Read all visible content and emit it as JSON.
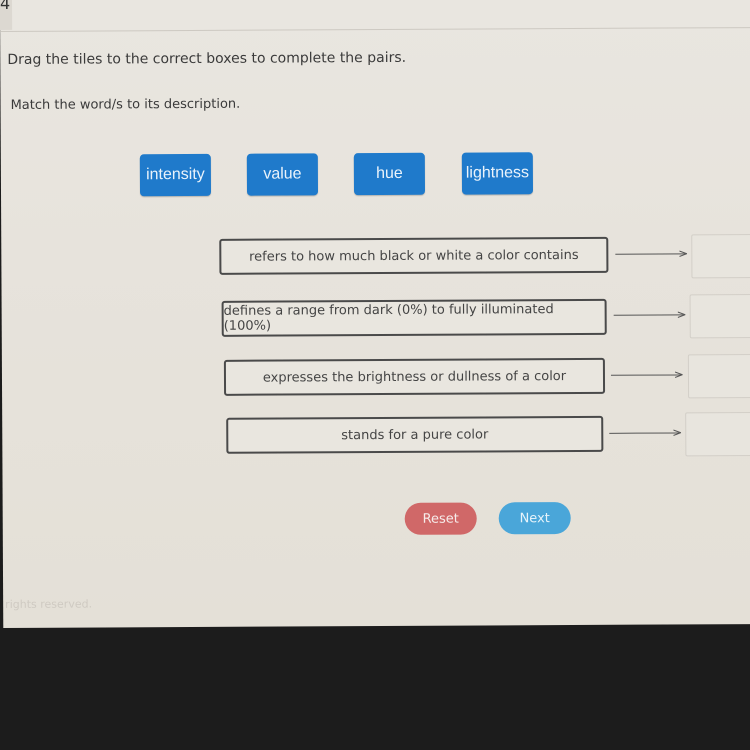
{
  "question": {
    "number": "4",
    "instruction": "Drag the tiles to the correct boxes to complete the pairs.",
    "subinstruction": "Match the word/s to its description."
  },
  "tiles": [
    {
      "label": "intensity"
    },
    {
      "label": "value"
    },
    {
      "label": "hue"
    },
    {
      "label": "lightness"
    }
  ],
  "pairs": [
    {
      "description": "refers to how much black or white a color contains",
      "answer": ""
    },
    {
      "description": "defines a range from dark (0%) to fully illuminated (100%)",
      "answer": ""
    },
    {
      "description": "expresses the brightness or dullness of a color",
      "answer": ""
    },
    {
      "description": "stands for a pure color",
      "answer": ""
    }
  ],
  "buttons": {
    "reset": "Reset",
    "next": "Next"
  },
  "footer": {
    "text": "rights reserved."
  },
  "colors": {
    "tile": "#1f7acb",
    "reset": "#d06868",
    "next": "#4aa6d9"
  }
}
